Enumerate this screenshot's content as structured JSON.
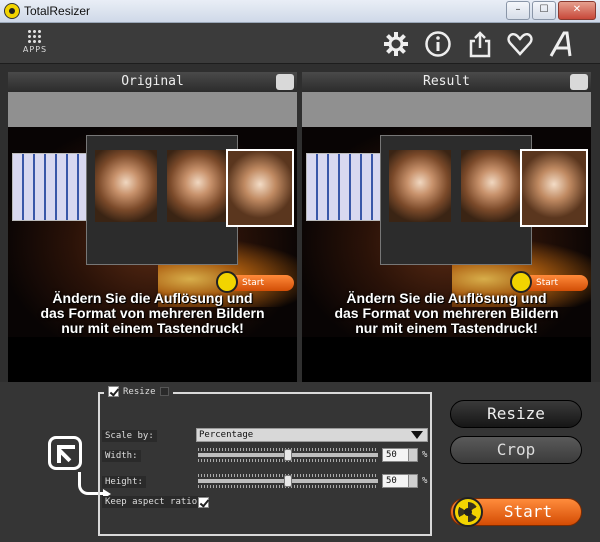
{
  "window": {
    "title": "TotalResizer",
    "min": "–",
    "max": "☐",
    "close": "✕"
  },
  "toolbar": {
    "apps_label": "APPS",
    "icons": [
      "gear-icon",
      "info-icon",
      "share-icon",
      "heart-icon",
      "font-a-icon"
    ]
  },
  "panels": {
    "original_title": "Original",
    "result_title": "Result",
    "preview": {
      "start_label": "Start",
      "caption_lines": [
        "Ändern Sie die Auflösung und",
        "das Format von mehreren Bildern",
        "nur mit einem Tastendruck!"
      ]
    }
  },
  "resize_group": {
    "checked": true,
    "title": "Resize",
    "scale_label": "Scale by:",
    "scale_value": "Percentage",
    "width_label": "Width:",
    "width_value": "50",
    "height_label": "Height:",
    "height_value": "50",
    "unit": "%",
    "aspect_label": "Keep aspect ratio:",
    "aspect_checked": true
  },
  "actions": {
    "resize": "Resize",
    "crop": "Crop",
    "start": "Start"
  },
  "colors": {
    "accent_orange": "#e9641c",
    "yellow": "#f2d400",
    "bg": "#2f2f2f"
  }
}
